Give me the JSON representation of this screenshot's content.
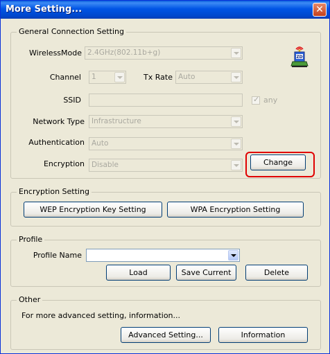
{
  "window": {
    "title": "More Setting..."
  },
  "general": {
    "group_label": "General Connection Setting",
    "wireless_mode": {
      "label": "WirelessMode",
      "value": "2.4GHz(802.11b+g)"
    },
    "channel": {
      "label": "Channel",
      "value": "1"
    },
    "tx_rate": {
      "label": "Tx Rate",
      "value": "Auto"
    },
    "ssid": {
      "label": "SSID",
      "value": "",
      "any_label": "any"
    },
    "network_type": {
      "label": "Network Type",
      "value": "Infrastructure"
    },
    "authentication": {
      "label": "Authentication",
      "value": "Auto"
    },
    "encryption": {
      "label": "Encryption",
      "value": "Disable"
    },
    "change_button": "Change"
  },
  "encryption_setting": {
    "group_label": "Encryption Setting",
    "wep_button": "WEP Encryption Key Setting",
    "wpa_button": "WPA Encryption Setting"
  },
  "profile": {
    "group_label": "Profile",
    "name_label": "Profile Name",
    "name_value": "",
    "load_button": "Load",
    "save_button": "Save Current",
    "delete_button": "Delete"
  },
  "other": {
    "group_label": "Other",
    "description": "For more advanced setting, information...",
    "advanced_button": "Advanced Setting...",
    "information_button": "Information"
  },
  "colors": {
    "titlebar": "#0055e5",
    "highlight": "#e00000",
    "dialog_bg": "#ECE9D8"
  }
}
